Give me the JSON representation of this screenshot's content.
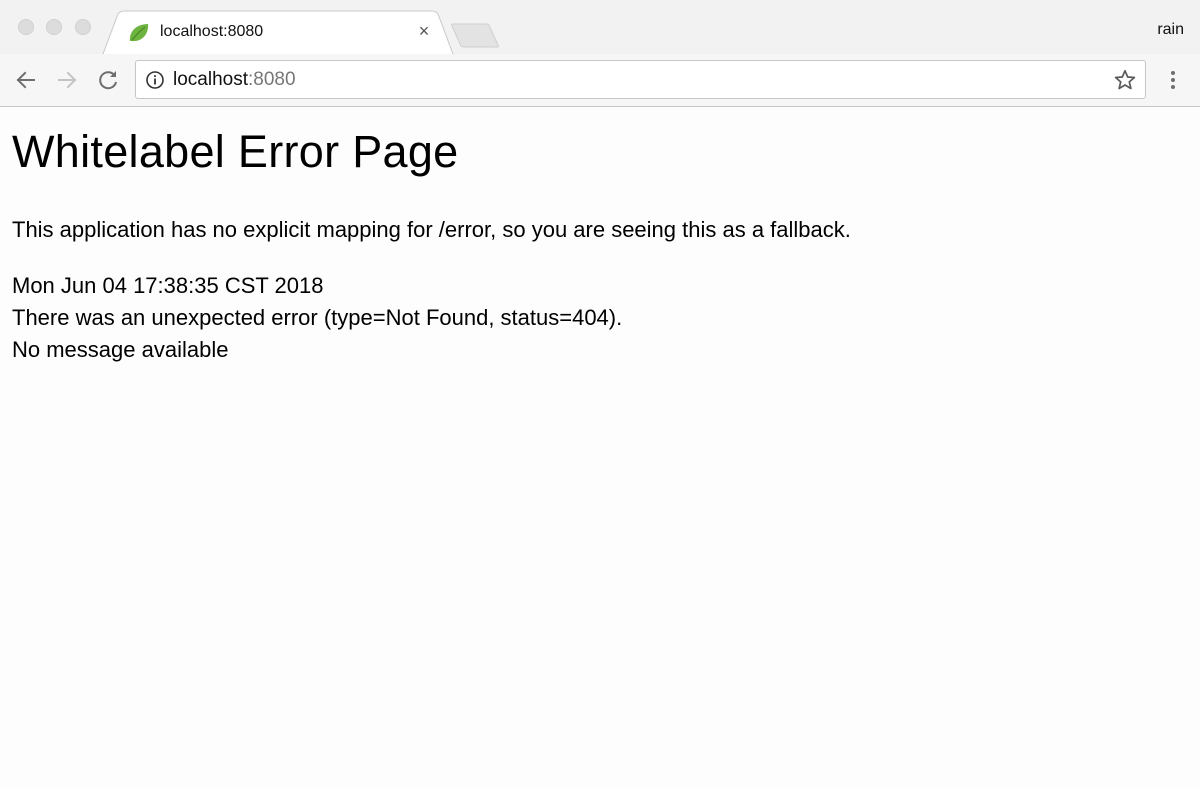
{
  "browser": {
    "tab": {
      "title": "localhost:8080",
      "favicon": "spring-leaf-icon",
      "close_glyph": "×"
    },
    "profile_name": "rain",
    "omnibox": {
      "host": "localhost",
      "port": ":8080",
      "icon": "info-icon"
    }
  },
  "page": {
    "heading": "Whitelabel Error Page",
    "message": "This application has no explicit mapping for /error, so you are seeing this as a fallback.",
    "timestamp": "Mon Jun 04 17:38:35 CST 2018",
    "error_line": "There was an unexpected error (type=Not Found, status=404).",
    "detail": "No message available"
  },
  "colors": {
    "favicon_green": "#6db33f"
  }
}
